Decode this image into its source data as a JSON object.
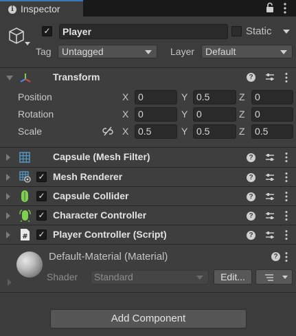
{
  "tab": {
    "title": "Inspector",
    "info_glyph": "i",
    "icons": [
      "lock-icon",
      "menu-icon"
    ]
  },
  "gameobject": {
    "name": "Player",
    "active": true,
    "static_label": "Static",
    "static_checked": false,
    "tag_label": "Tag",
    "tag_value": "Untagged",
    "layer_label": "Layer",
    "layer_value": "Default",
    "icon": "cube-icon"
  },
  "transform": {
    "title": "Transform",
    "icon": "transform-axes-icon",
    "help_glyph": "?",
    "rows": [
      {
        "label": "Position",
        "x": "0",
        "y": "0.5",
        "z": "0"
      },
      {
        "label": "Rotation",
        "x": "0",
        "y": "0",
        "z": "0"
      },
      {
        "label": "Scale",
        "x": "0.5",
        "y": "0.5",
        "z": "0.5"
      }
    ],
    "axis_labels": {
      "x": "X",
      "y": "Y",
      "z": "Z"
    },
    "scale_link_icon": "unlinked-chain-icon"
  },
  "components": [
    {
      "title": "Capsule (Mesh Filter)",
      "icon": "mesh-filter-grid-icon",
      "has_checkbox": false,
      "checked": false
    },
    {
      "title": "Mesh Renderer",
      "icon": "mesh-renderer-icon",
      "has_checkbox": true,
      "checked": true
    },
    {
      "title": "Capsule Collider",
      "icon": "capsule-collider-icon",
      "has_checkbox": true,
      "checked": true
    },
    {
      "title": "Character Controller",
      "icon": "character-controller-icon",
      "has_checkbox": true,
      "checked": true
    },
    {
      "title": "Player Controller (Script)",
      "icon": "csharp-script-icon",
      "has_checkbox": true,
      "checked": true
    }
  ],
  "material": {
    "name": "Default-Material (Material)",
    "shader_label": "Shader",
    "shader_value": "Standard",
    "edit_label": "Edit...",
    "help_glyph": "?"
  },
  "add_component_label": "Add Component",
  "colors": {
    "background": "#282828",
    "panel": "#3e3e3e",
    "accent_tab": "#3a79bb",
    "collider_green": "#7ed050",
    "mesh_blue": "#58a6d8"
  }
}
